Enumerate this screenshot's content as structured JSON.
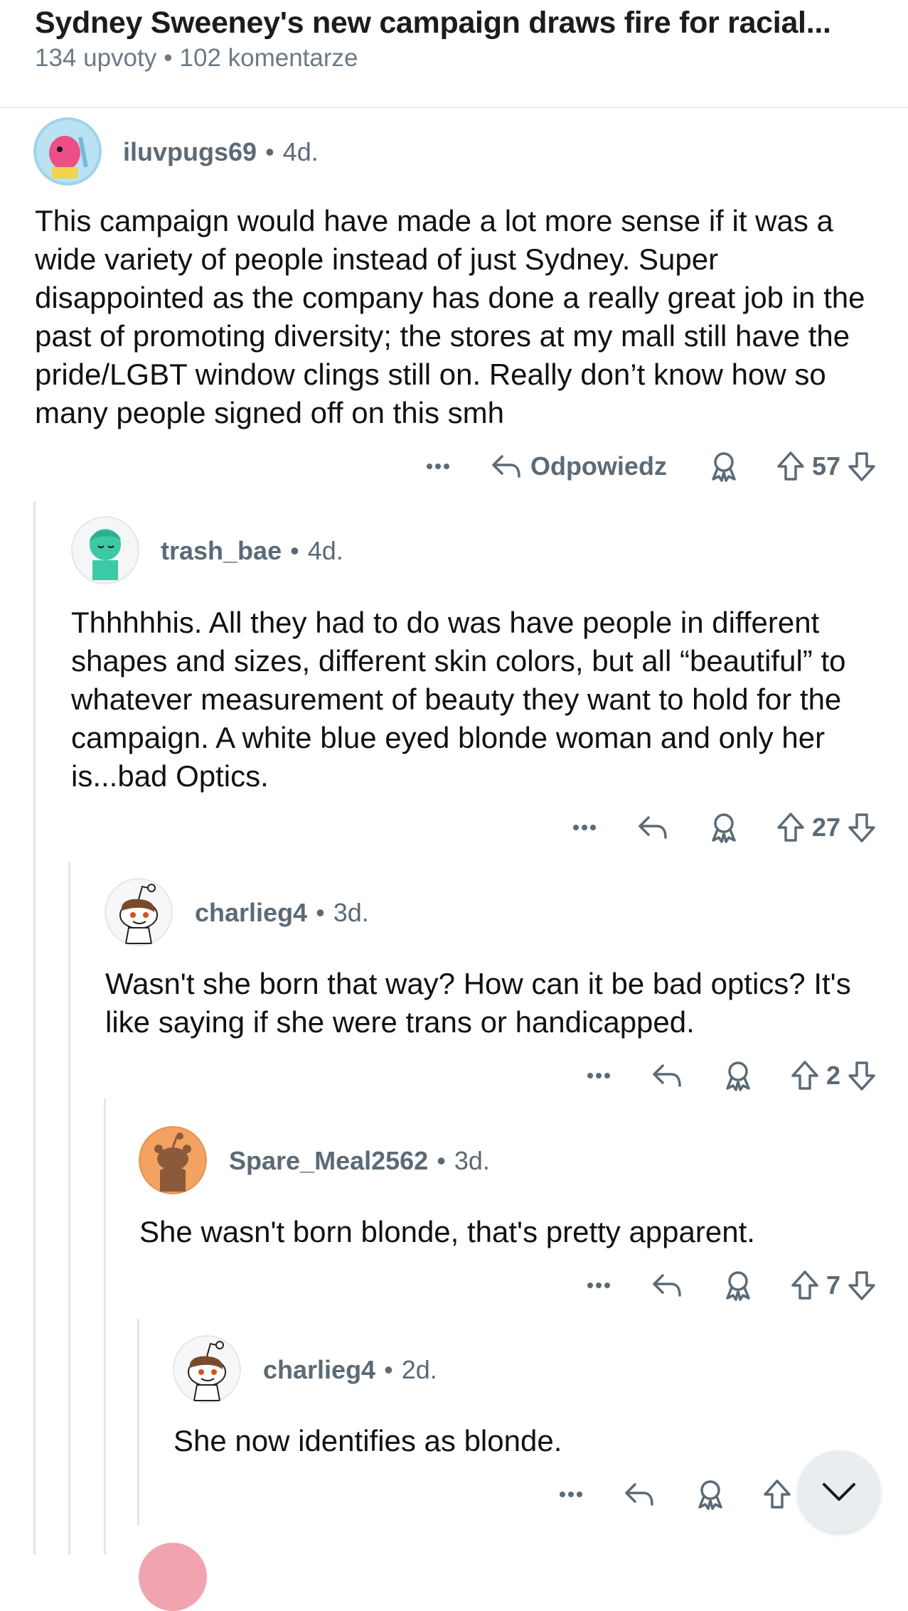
{
  "post": {
    "title": "Sydney Sweeney's new campaign draws fire for racial...",
    "upvotes": "134 upvoty",
    "comments": "102 komentarze"
  },
  "comments": [
    {
      "user": "iluvpugs69",
      "age": "4d.",
      "text": "This campaign would have made a lot more sense if it was a wide variety of people instead of just Sydney. Super disappointed as the company has done a really great job in the past of promoting diversity; the stores at my mall still have the pride/LGBT window clings still on. Really don’t know how so many people signed off on this smh",
      "reply_label": "Odpowiedz",
      "votes": "57"
    },
    {
      "user": "trash_bae",
      "age": "4d.",
      "text": "Thhhhhis. All they had to do was have people in different shapes and sizes, different skin colors, but all “beautiful” to whatever measurement of beauty they want to hold for the campaign. A white blue eyed blonde woman and only her is...bad Optics.",
      "votes": "27"
    },
    {
      "user": "charlieg4",
      "age": "3d.",
      "text": "Wasn't she born that way?  How can it be bad optics? It's like saying if she were trans or handicapped.",
      "votes": "2"
    },
    {
      "user": "Spare_Meal2562",
      "age": "3d.",
      "text": "She wasn't born blonde, that's pretty apparent.",
      "votes": "7"
    },
    {
      "user": "charlieg4",
      "age": "2d.",
      "text": "She now identifies as blonde."
    }
  ],
  "icons": {
    "more": "more-icon",
    "reply": "reply-icon",
    "award": "award-icon",
    "upvote": "upvote-icon",
    "downvote": "downvote-icon",
    "jump": "chevron-down-icon"
  },
  "colors": {
    "meta": "#5b6a76",
    "thread_line": "#e2e6e9",
    "orange_avatar": "#f4a261"
  }
}
